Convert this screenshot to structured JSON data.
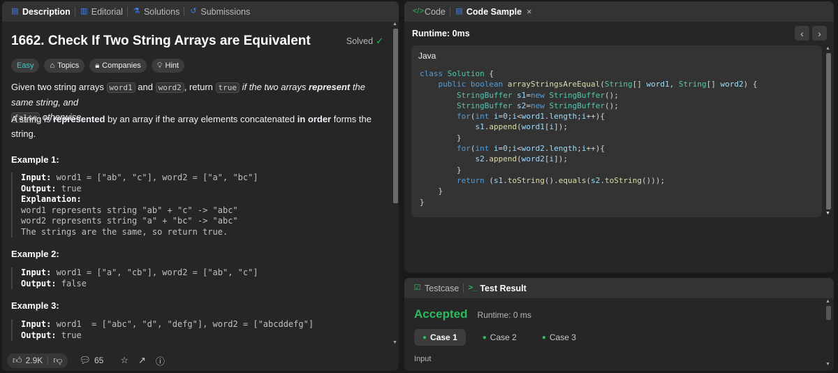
{
  "left_tabs": [
    {
      "label": "Description",
      "icon": "description-icon"
    },
    {
      "label": "Editorial",
      "icon": "book-icon"
    },
    {
      "label": "Solutions",
      "icon": "flask-icon"
    },
    {
      "label": "Submissions",
      "icon": "history-icon"
    }
  ],
  "problem": {
    "title": "1662. Check If Two String Arrays are Equivalent",
    "solved": "Solved",
    "tags": {
      "difficulty": "Easy",
      "topics": "Topics",
      "companies": "Companies",
      "hint": "Hint"
    },
    "p1": {
      "a": "Given two string arrays ",
      "word1": "word1",
      "and": " and ",
      "word2": "word2",
      "comma": ", return ",
      "true": "true",
      "if_two": " if the two arrays ",
      "represent": "represent",
      "same": " the same string, and",
      "false": "false",
      "otherwise": " otherwise."
    },
    "p2": {
      "a": "A string is ",
      "represented": "represented",
      "b": " by an array if the array elements concatenated ",
      "in_order": "in order",
      "c": " forms the string."
    },
    "examples": [
      {
        "title": "Example 1:",
        "lines": [
          {
            "k": "Input:",
            "v": " word1 = [\"ab\", \"c\"], word2 = [\"a\", \"bc\"]"
          },
          {
            "k": "Output:",
            "v": " true"
          },
          {
            "k": "Explanation:",
            "v": ""
          },
          {
            "k": "",
            "v": "word1 represents string \"ab\" + \"c\" -> \"abc\""
          },
          {
            "k": "",
            "v": "word2 represents string \"a\" + \"bc\" -> \"abc\""
          },
          {
            "k": "",
            "v": "The strings are the same, so return true."
          }
        ]
      },
      {
        "title": "Example 2:",
        "lines": [
          {
            "k": "Input:",
            "v": " word1 = [\"a\", \"cb\"], word2 = [\"ab\", \"c\"]"
          },
          {
            "k": "Output:",
            "v": " false"
          }
        ]
      },
      {
        "title": "Example 3:",
        "lines": [
          {
            "k": "Input:",
            "v": " word1  = [\"abc\", \"d\", \"defg\"], word2 = [\"abcddefg\"]"
          },
          {
            "k": "Output:",
            "v": " true"
          }
        ]
      }
    ]
  },
  "footer": {
    "likes": "2.9K",
    "comments": "65"
  },
  "right_tabs": [
    {
      "label": "Code",
      "icon": "code-icon"
    },
    {
      "label": "Code Sample",
      "icon": "file-icon",
      "close": "×"
    }
  ],
  "runtime_label": "Runtime: 0ms",
  "language": "Java",
  "code_lines": [
    "class Solution {",
    "    public boolean arrayStringsAreEqual(String[] word1, String[] word2) {",
    "        StringBuffer s1=new StringBuffer();",
    "        StringBuffer s2=new StringBuffer();",
    "        for(int i=0;i<word1.length;i++){",
    "            s1.append(word1[i]);",
    "        }",
    "        for(int i=0;i<word2.length;i++){",
    "            s2.append(word2[i]);",
    "        }",
    "        return (s1.toString().equals(s2.toString()));",
    "    }",
    "}"
  ],
  "bottom_tabs": [
    {
      "label": "Testcase",
      "icon": "checkbox-icon"
    },
    {
      "label": "Test Result",
      "icon": "terminal-icon"
    }
  ],
  "result": {
    "status": "Accepted",
    "runtime": "Runtime: 0 ms",
    "cases": [
      "Case 1",
      "Case 2",
      "Case 3"
    ],
    "input_label": "Input"
  },
  "colors": {
    "accepted": "#2cbb5d",
    "easy": "#46c6c2",
    "tab_blue": "#3b82f6"
  }
}
